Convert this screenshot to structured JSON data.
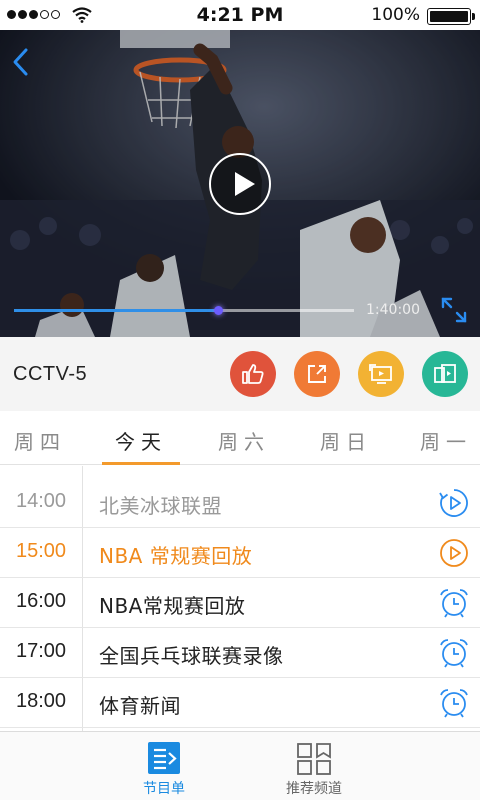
{
  "status_bar": {
    "time": "4:21 PM",
    "battery": "100%",
    "signal_bars_filled": 3,
    "signal_bars_total": 5,
    "battery_level": 1.0
  },
  "player": {
    "duration": "1:40:00",
    "progress_fraction": 0.6,
    "icons": [
      "back-chevron-icon",
      "play-icon",
      "fullscreen-expand-icon"
    ]
  },
  "channel": {
    "name": "CCTV-5",
    "actions": [
      {
        "id": "like",
        "icon": "thumbs-up-icon",
        "color": "#e0533b"
      },
      {
        "id": "share",
        "icon": "share-icon",
        "color": "#f07a35"
      },
      {
        "id": "cast",
        "icon": "tv-cast-icon",
        "color": "#f2b233"
      },
      {
        "id": "mirror",
        "icon": "screen-mirror-icon",
        "color": "#27b796"
      }
    ]
  },
  "day_tabs": [
    {
      "label": "周四",
      "active": false
    },
    {
      "label": "今天",
      "active": true
    },
    {
      "label": "周六",
      "active": false
    },
    {
      "label": "周日",
      "active": false
    },
    {
      "label": "周一",
      "active": false
    }
  ],
  "schedule": [
    {
      "time": "14:00",
      "title": "北美冰球联盟",
      "state": "past",
      "icon": "replay-icon"
    },
    {
      "time": "15:00",
      "title": "NBA 常规赛回放",
      "state": "live",
      "icon": "play-circle-icon"
    },
    {
      "time": "16:00",
      "title": "NBA常规赛回放",
      "state": "upcoming",
      "icon": "alarm-clock-icon"
    },
    {
      "time": "17:00",
      "title": "全国兵乓球联赛录像",
      "state": "upcoming",
      "icon": "alarm-clock-icon"
    },
    {
      "time": "18:00",
      "title": "体育新闻",
      "state": "upcoming",
      "icon": "alarm-clock-icon"
    }
  ],
  "bottom_nav": [
    {
      "label": "节目单",
      "icon": "program-list-icon",
      "active": true
    },
    {
      "label": "推荐频道",
      "icon": "channel-grid-icon",
      "active": false
    }
  ],
  "colors": {
    "accent_blue": "#1a8ae0",
    "accent_orange": "#f08a1c",
    "tab_underline": "#f39a2c"
  }
}
